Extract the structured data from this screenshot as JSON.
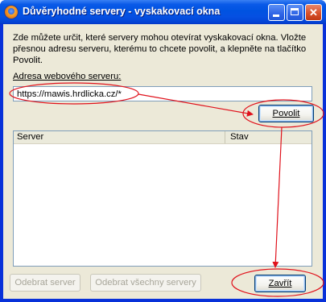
{
  "window": {
    "title": "Důvěryhodné servery - vyskakovací okna",
    "app_icon": "firefox-icon",
    "title_bar_color": "#0053e1"
  },
  "title_buttons": {
    "minimize": "minimize-icon",
    "maximize": "maximize-icon",
    "close": "✕"
  },
  "description": "Zde můžete určit, které servery mohou otevírat vyskakovací okna. Vložte přesnou adresu serveru, kterému to chcete povolit, a klepněte na tlačítko Povolit.",
  "url_field": {
    "label": "Adresa webového serveru:",
    "value": "https://mawis.hrdlicka.cz/*"
  },
  "allow_button": "Povolit",
  "server_list": {
    "columns": [
      "Server",
      "Stav"
    ],
    "rows": []
  },
  "buttons": {
    "remove_server": "Odebrat server",
    "remove_all": "Odebrat všechny servery",
    "close": "Zavřít"
  },
  "annotation_color": "#e0121c"
}
